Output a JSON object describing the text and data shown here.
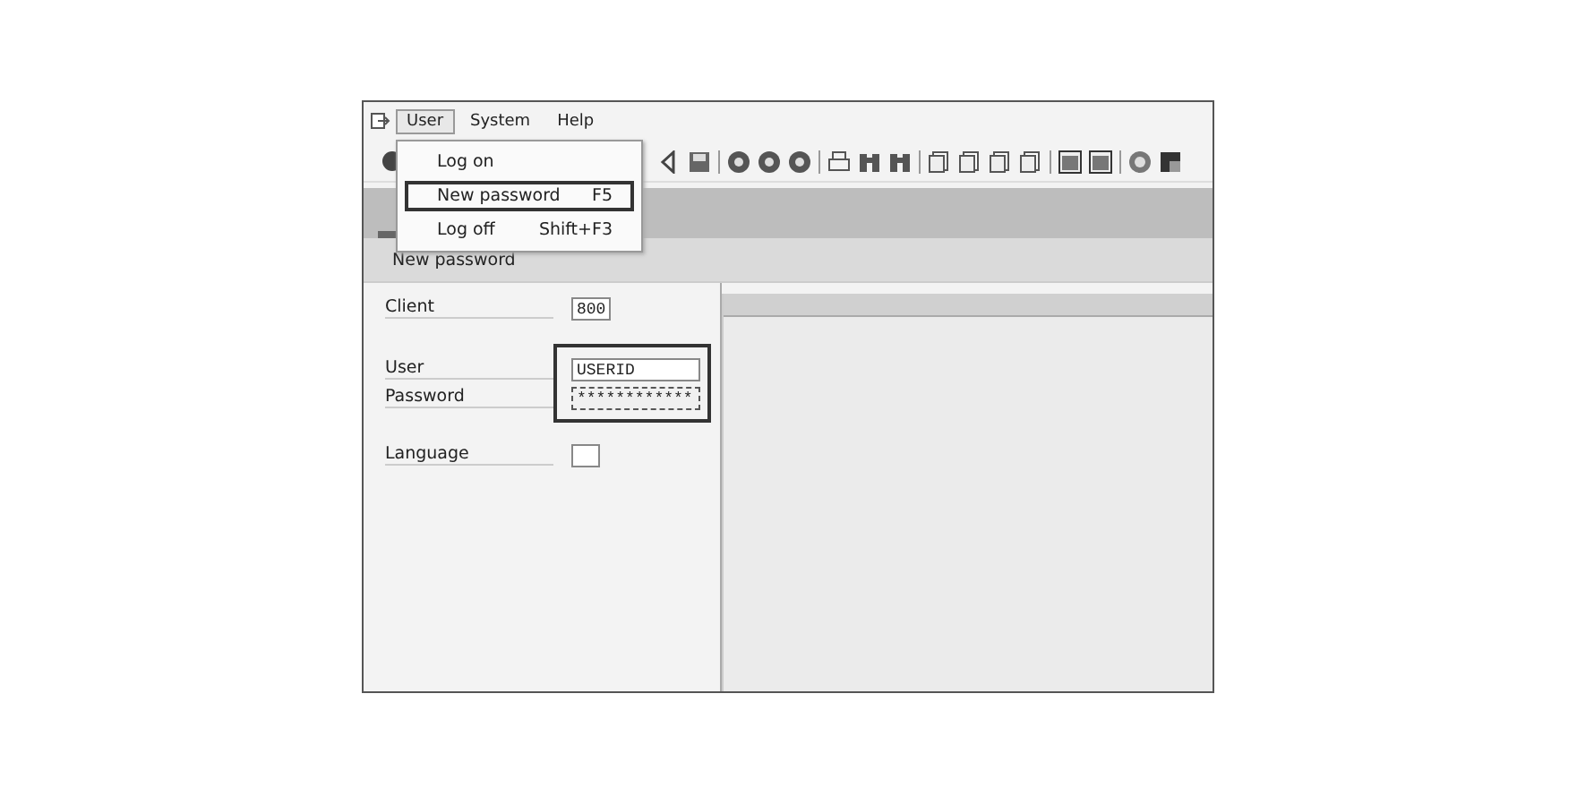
{
  "menu_bar": [
    {
      "label": "User",
      "selected": true
    },
    {
      "label": "System",
      "selected": false
    },
    {
      "label": "Help",
      "selected": false
    }
  ],
  "dropdown": [
    {
      "label": "Log on",
      "selected": false
    },
    {
      "label": "New password",
      "shortcut": "F5",
      "selected": true
    },
    {
      "label": "Log off",
      "shortcut": "Shift+F3",
      "selected": false
    }
  ],
  "screen_title": "New password",
  "fields": [
    {
      "label": "Client",
      "value": "800",
      "focused": false,
      "highlighted": false
    },
    {
      "label": "User",
      "value": "USERID",
      "focused": false,
      "highlighted": true
    },
    {
      "label": "Password",
      "value": "************",
      "focused": true,
      "highlighted": true
    },
    {
      "label": "Language",
      "focused": false,
      "highlighted": false
    }
  ]
}
